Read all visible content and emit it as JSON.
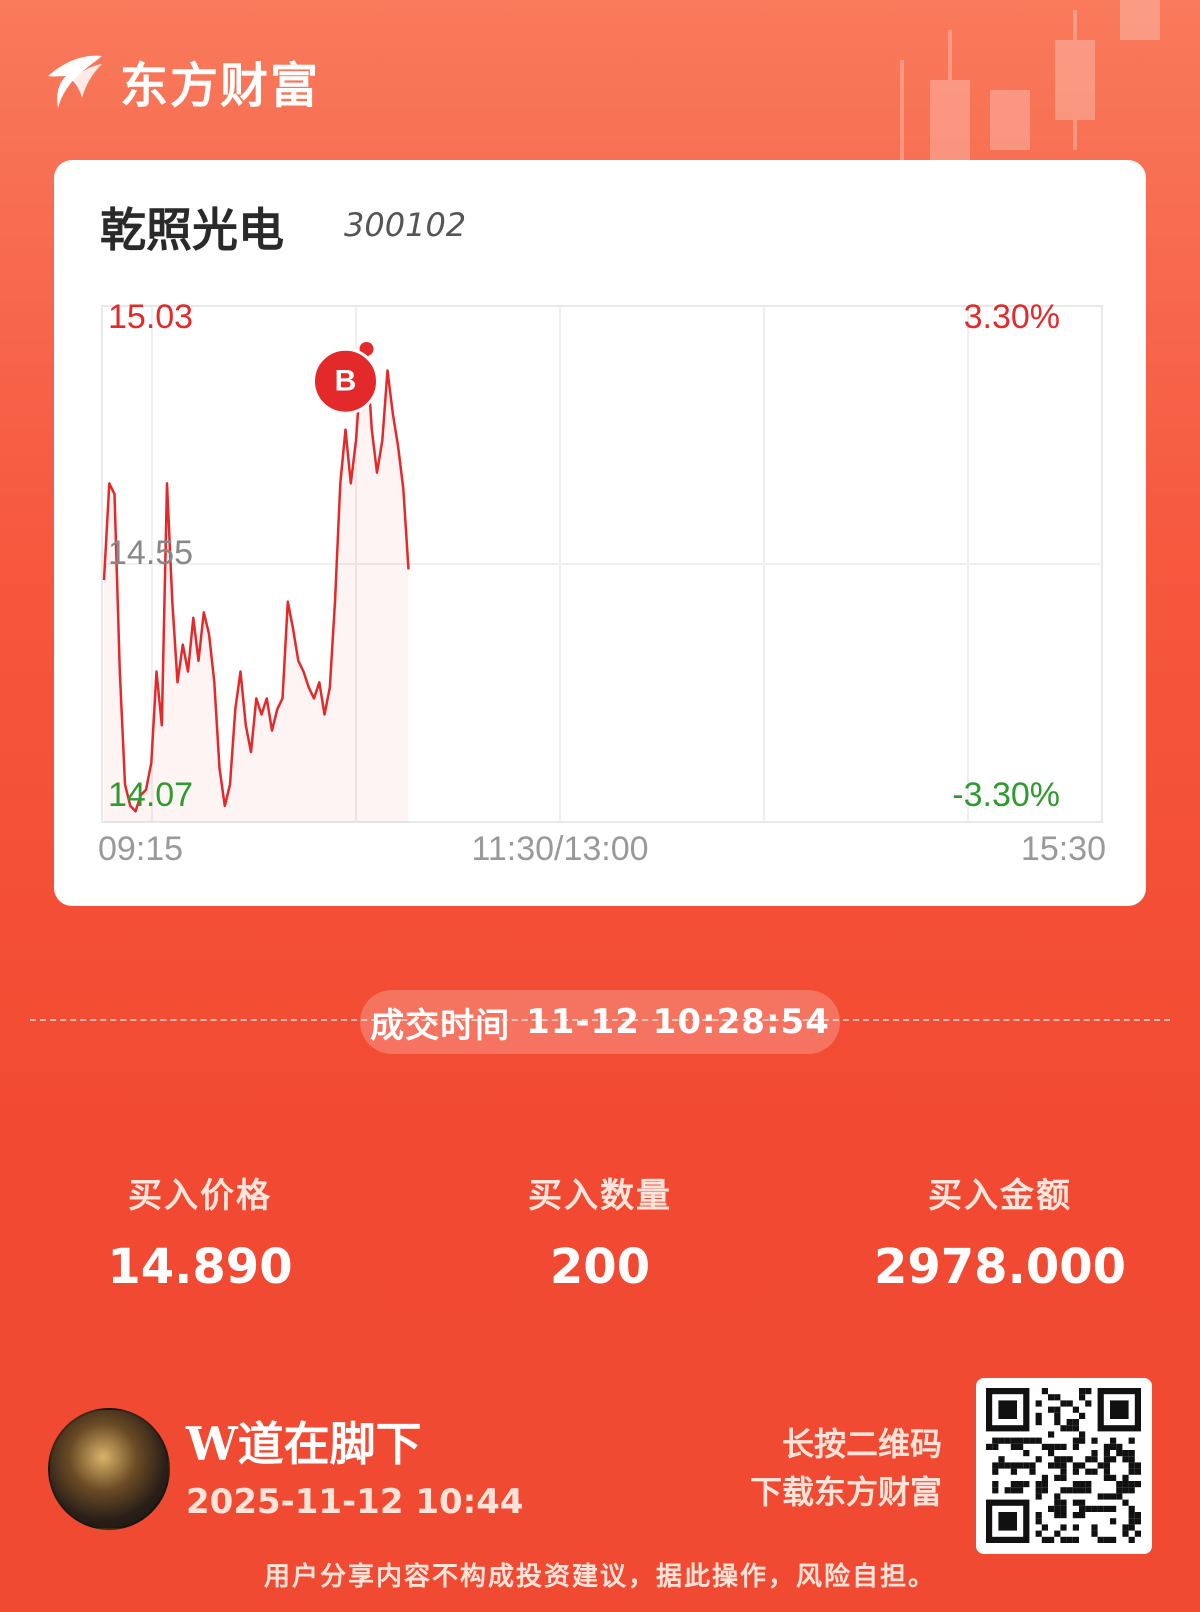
{
  "brand": {
    "name": "东方财富"
  },
  "stock": {
    "name": "乾照光电",
    "code": "300102"
  },
  "chart_data": {
    "type": "line",
    "y_labels": {
      "top": "15.03",
      "mid": "14.55",
      "bottom": "14.07"
    },
    "pct_labels": {
      "top": "3.30%",
      "bottom": "-3.30%"
    },
    "x_labels": {
      "start": "09:15",
      "mid": "11:30/13:00",
      "end": "15:30"
    },
    "ylim": [
      14.07,
      15.03
    ],
    "buy_marker": {
      "label": "B",
      "price": 14.89
    },
    "colors": {
      "line": "#e4292b",
      "up": "#e4292b",
      "down": "#2f9a2f",
      "neutral": "#888888"
    },
    "series": [
      {
        "values": [
          14.52,
          14.7,
          14.68,
          14.35,
          14.14,
          14.1,
          14.09,
          14.12,
          14.13,
          14.18,
          14.35,
          14.25,
          14.7,
          14.48,
          14.33,
          14.4,
          14.35,
          14.45,
          14.37,
          14.46,
          14.42,
          14.33,
          14.17,
          14.1,
          14.14,
          14.28,
          14.35,
          14.25,
          14.2,
          14.3,
          14.27,
          14.3,
          14.24,
          14.28,
          14.3,
          14.48,
          14.43,
          14.37,
          14.35,
          14.32,
          14.3,
          14.33,
          14.27,
          14.32,
          14.48,
          14.7,
          14.8,
          14.7,
          14.78,
          14.92,
          14.95,
          14.8,
          14.72,
          14.78,
          14.91,
          14.83,
          14.77,
          14.69,
          14.54
        ]
      }
    ]
  },
  "trade": {
    "time_label": "成交时间",
    "time_value": "11-12 10:28:54"
  },
  "metrics": [
    {
      "label": "买入价格",
      "value": "14.890"
    },
    {
      "label": "买入数量",
      "value": "200"
    },
    {
      "label": "买入金额",
      "value": "2978.000"
    }
  ],
  "user": {
    "name": "W道在脚下",
    "datetime": "2025-11-12 10:44"
  },
  "qr_hint": {
    "line1": "长按二维码",
    "line2": "下载东方财富"
  },
  "disclaimer": "用户分享内容不构成投资建议，据此操作，风险自担。"
}
